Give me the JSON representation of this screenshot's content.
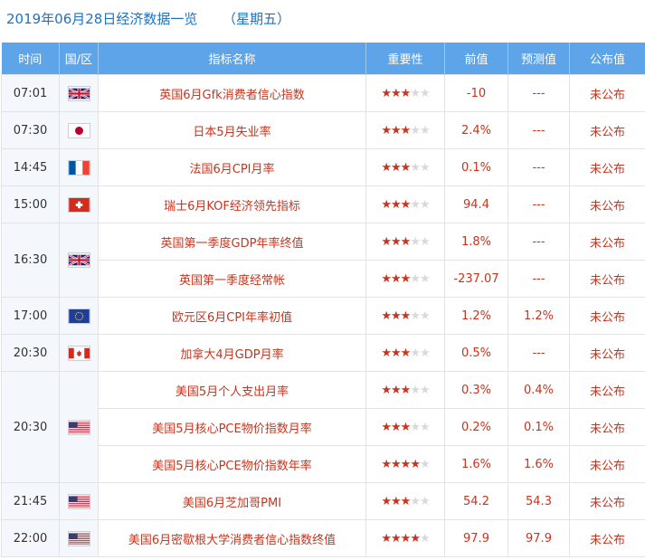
{
  "header": {
    "date": "2019年06月28日经济数据一览",
    "weekday": "（星期五）"
  },
  "columns": [
    "时间",
    "国/区",
    "指标名称",
    "重要性",
    "前值",
    "预测值",
    "公布值"
  ],
  "groups": [
    {
      "time": "07:01",
      "flag": "uk-flag-icon",
      "rows": [
        {
          "name": "英国6月Gfk消费者信心指数",
          "stars": 3,
          "prev": "-10",
          "forecast": "---",
          "actual": "未公布"
        }
      ]
    },
    {
      "time": "07:30",
      "flag": "japan-flag-icon",
      "rows": [
        {
          "name": "日本5月失业率",
          "stars": 3,
          "prev": "2.4%",
          "forecast": "---",
          "actual": "未公布"
        }
      ]
    },
    {
      "time": "14:45",
      "flag": "france-flag-icon",
      "rows": [
        {
          "name": "法国6月CPI月率",
          "stars": 3,
          "prev": "0.1%",
          "forecast": "---",
          "actual": "未公布"
        }
      ]
    },
    {
      "time": "15:00",
      "flag": "switzerland-flag-icon",
      "rows": [
        {
          "name": "瑞士6月KOF经济领先指标",
          "stars": 3,
          "prev": "94.4",
          "forecast": "---",
          "actual": "未公布"
        }
      ]
    },
    {
      "time": "16:30",
      "flag": "uk-flag-icon",
      "rows": [
        {
          "name": "英国第一季度GDP年率终值",
          "stars": 3,
          "prev": "1.8%",
          "forecast": "---",
          "actual": "未公布"
        },
        {
          "name": "英国第一季度经常帐",
          "stars": 3,
          "prev": "-237.07",
          "forecast": "---",
          "actual": "未公布"
        }
      ]
    },
    {
      "time": "17:00",
      "flag": "eu-flag-icon",
      "rows": [
        {
          "name": "欧元区6月CPI年率初值",
          "stars": 3,
          "prev": "1.2%",
          "forecast": "1.2%",
          "actual": "未公布"
        }
      ]
    },
    {
      "time": "20:30",
      "flag": "canada-flag-icon",
      "rows": [
        {
          "name": "加拿大4月GDP月率",
          "stars": 3,
          "prev": "0.5%",
          "forecast": "---",
          "actual": "未公布"
        }
      ]
    },
    {
      "time": "20:30",
      "flag": "usa-flag-icon",
      "rows": [
        {
          "name": "美国5月个人支出月率",
          "stars": 3,
          "prev": "0.3%",
          "forecast": "0.4%",
          "actual": "未公布"
        },
        {
          "name": "美国5月核心PCE物价指数月率",
          "stars": 3,
          "prev": "0.2%",
          "forecast": "0.1%",
          "actual": "未公布"
        },
        {
          "name": "美国5月核心PCE物价指数年率",
          "stars": 4,
          "prev": "1.6%",
          "forecast": "1.6%",
          "actual": "未公布"
        }
      ]
    },
    {
      "time": "21:45",
      "flag": "usa-flag-icon",
      "rows": [
        {
          "name": "美国6月芝加哥PMI",
          "stars": 3,
          "prev": "54.2",
          "forecast": "54.3",
          "actual": "未公布"
        }
      ]
    },
    {
      "time": "22:00",
      "flag": "usa-flag-icon",
      "rows": [
        {
          "name": "美国6月密歇根大学消费者信心指数终值",
          "stars": 4,
          "prev": "97.9",
          "forecast": "97.9",
          "actual": "未公布"
        }
      ]
    }
  ],
  "colors": {
    "header_bg": "#5da4e8",
    "accent_red": "#c8341d",
    "title_blue": "#1e73be"
  }
}
